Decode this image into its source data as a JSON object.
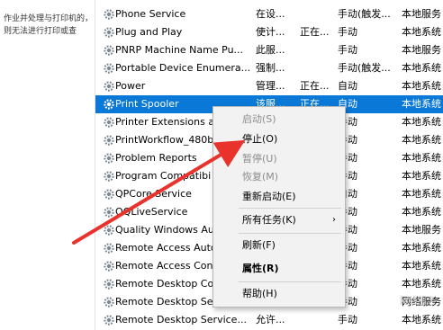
{
  "left_pane": {
    "description": "作业并处理与打印机的，则无法进行打印或查"
  },
  "services": [
    {
      "name": "Phone Service",
      "description": "在设...",
      "status": "",
      "startup": "手动(触发...",
      "logon": "本地服务"
    },
    {
      "name": "Plug and Play",
      "description": "使计...",
      "status": "正在...",
      "startup": "手动",
      "logon": "本地系统"
    },
    {
      "name": "PNRP Machine Name Pu...",
      "description": "此服...",
      "status": "",
      "startup": "手动",
      "logon": "本地服务"
    },
    {
      "name": "Portable Device Enumera...",
      "description": "强制...",
      "status": "",
      "startup": "手动(触发...",
      "logon": "本地系统"
    },
    {
      "name": "Power",
      "description": "管理...",
      "status": "正在...",
      "startup": "自动",
      "logon": "本地系统"
    },
    {
      "name": "Print Spooler",
      "description": "该服...",
      "status": "正在...",
      "startup": "自动",
      "logon": "本地系统",
      "selected": true
    },
    {
      "name": "Printer Extensions a",
      "description": "",
      "status": "",
      "startup": "手动",
      "logon": "本地系统"
    },
    {
      "name": "PrintWorkflow_480b",
      "description": "",
      "status": "",
      "startup": "手动",
      "logon": "本地系统"
    },
    {
      "name": "Problem Reports",
      "description": "",
      "status": "",
      "startup": "手动",
      "logon": "本地系统"
    },
    {
      "name": "Program Compatibi",
      "description": "",
      "status": "",
      "startup": "手动",
      "logon": "本地系统"
    },
    {
      "name": "QPCore Service",
      "description": "",
      "status": "",
      "startup": "自动",
      "logon": "本地系统"
    },
    {
      "name": "QQLiveService",
      "description": "",
      "status": "",
      "startup": "手动",
      "logon": "本地系统"
    },
    {
      "name": "Quality Windows Au",
      "description": "",
      "status": "",
      "startup": "手动",
      "logon": "本地服务"
    },
    {
      "name": "Remote Access Auto",
      "description": "",
      "status": "",
      "startup": "手动",
      "logon": "本地系统"
    },
    {
      "name": "Remote Access Con",
      "description": "",
      "status": "",
      "startup": "手动",
      "logon": "本地系统"
    },
    {
      "name": "Remote Desktop Co",
      "description": "",
      "status": "",
      "startup": "手动",
      "logon": "本地系统"
    },
    {
      "name": "Remote Desktop Se",
      "description": "",
      "status": "",
      "startup": "手动",
      "logon": "网络服务"
    },
    {
      "name": "Remote Desktop Service...",
      "description": "允许...",
      "status": "",
      "startup": "手动",
      "logon": "本地系统"
    }
  ],
  "context_menu": {
    "items": [
      {
        "label": "启动(S)",
        "enabled": false
      },
      {
        "label": "停止(O)",
        "enabled": true
      },
      {
        "label": "暂停(U)",
        "enabled": false
      },
      {
        "label": "恢复(M)",
        "enabled": false
      },
      {
        "label": "重新启动(E)",
        "enabled": true
      },
      {
        "label": "所有任务(K)",
        "enabled": true,
        "submenu": true
      },
      {
        "label": "刷新(F)",
        "enabled": true
      },
      {
        "label": "属性(R)",
        "enabled": true,
        "bold": true
      },
      {
        "label": "帮助(H)",
        "enabled": true
      }
    ],
    "submenu_glyph": "›"
  },
  "annotation": {
    "arrow_color": "#e8322b"
  },
  "colors": {
    "selection": "#0a78d7",
    "menu_bg": "#f2f2f2"
  },
  "icons": {
    "service": "gear-icon"
  }
}
